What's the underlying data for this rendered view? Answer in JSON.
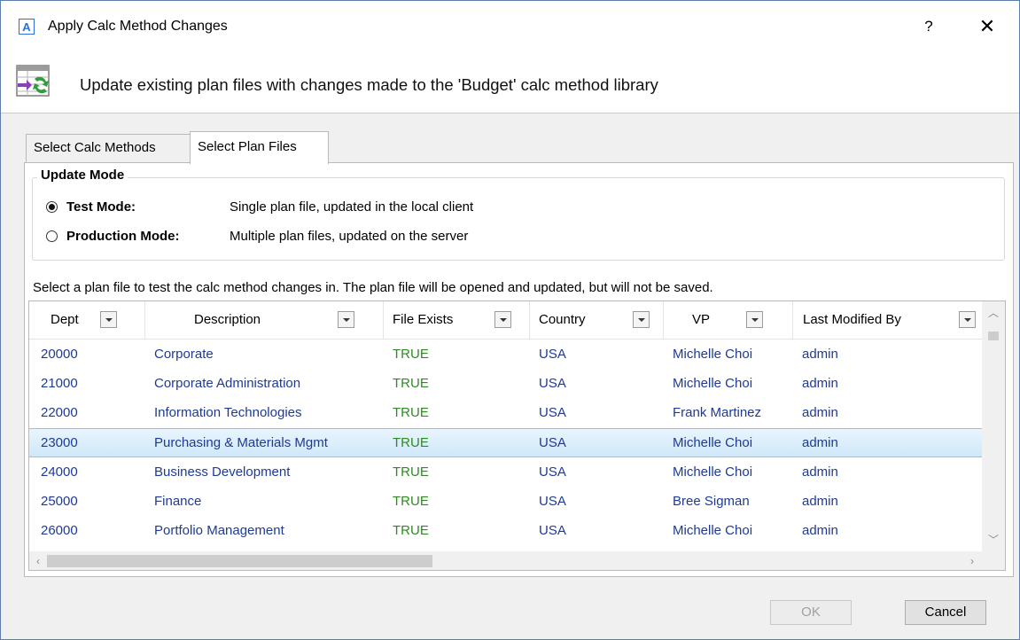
{
  "window": {
    "title": "Apply Calc Method Changes",
    "app_icon_letter": "A",
    "help_label": "?",
    "close_label": "✕"
  },
  "header": {
    "text": "Update existing plan files with changes made to the 'Budget' calc method library",
    "icon": "sync-calc-method-icon"
  },
  "tabs": [
    {
      "label": "Select Calc Methods",
      "active": false
    },
    {
      "label": "Select Plan Files",
      "active": true
    }
  ],
  "update_mode": {
    "legend": "Update Mode",
    "options": [
      {
        "label": "Test Mode:",
        "description": "Single plan file, updated in the local client",
        "checked": true
      },
      {
        "label": "Production Mode:",
        "description": "Multiple plan files, updated on the server",
        "checked": false
      }
    ]
  },
  "instruction": "Select a plan file to test the calc method changes in. The plan file will be opened and updated, but will not be saved.",
  "grid": {
    "columns": [
      "Dept",
      "Description",
      "File Exists",
      "Country",
      "VP",
      "Last Modified By"
    ],
    "rows": [
      {
        "dept": "20000",
        "description": "Corporate",
        "file_exists": "TRUE",
        "country": "USA",
        "vp": "Michelle Choi",
        "modified_by": "admin",
        "selected": false
      },
      {
        "dept": "21000",
        "description": "Corporate Administration",
        "file_exists": "TRUE",
        "country": "USA",
        "vp": "Michelle Choi",
        "modified_by": "admin",
        "selected": false
      },
      {
        "dept": "22000",
        "description": "Information Technologies",
        "file_exists": "TRUE",
        "country": "USA",
        "vp": "Frank Martinez",
        "modified_by": "admin",
        "selected": false
      },
      {
        "dept": "23000",
        "description": "Purchasing & Materials Mgmt",
        "file_exists": "TRUE",
        "country": "USA",
        "vp": "Michelle Choi",
        "modified_by": "admin",
        "selected": true
      },
      {
        "dept": "24000",
        "description": "Business Development",
        "file_exists": "TRUE",
        "country": "USA",
        "vp": "Michelle Choi",
        "modified_by": "admin",
        "selected": false
      },
      {
        "dept": "25000",
        "description": "Finance",
        "file_exists": "TRUE",
        "country": "USA",
        "vp": "Bree Sigman",
        "modified_by": "admin",
        "selected": false
      },
      {
        "dept": "26000",
        "description": "Portfolio Management",
        "file_exists": "TRUE",
        "country": "USA",
        "vp": "Michelle Choi",
        "modified_by": "admin",
        "selected": false
      }
    ]
  },
  "buttons": {
    "ok": "OK",
    "ok_enabled": false,
    "cancel": "Cancel"
  },
  "colors": {
    "link_text": "#1f3a93",
    "true_text": "#2e8b22",
    "selected_row": "#cfe8f9",
    "border_accent": "#5b7fae"
  }
}
